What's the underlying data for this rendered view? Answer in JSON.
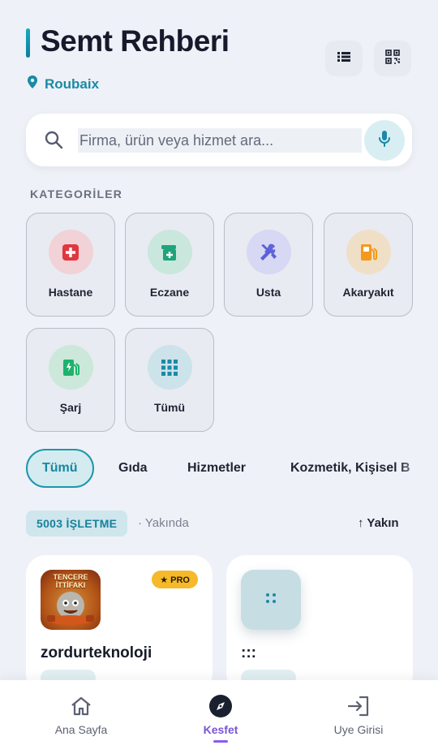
{
  "header": {
    "title": "Semt Rehberi",
    "location": "Roubaix",
    "accent": "#1a8aa6"
  },
  "search": {
    "placeholder": "Firma, ürün veya hizmet ara..."
  },
  "categories": {
    "heading": "KATEGORİLER",
    "items": [
      {
        "label": "Hastane",
        "icon": "hospital-icon",
        "color": "#e0383e"
      },
      {
        "label": "Eczane",
        "icon": "pharmacy-icon",
        "color": "#1fa37a"
      },
      {
        "label": "Usta",
        "icon": "tools-icon",
        "color": "#5b5fd8"
      },
      {
        "label": "Akaryakıt",
        "icon": "fuel-icon",
        "color": "#f39a1c"
      },
      {
        "label": "Şarj",
        "icon": "charging-icon",
        "color": "#1cb36c"
      },
      {
        "label": "Tümü",
        "icon": "grid-icon",
        "color": "#1a8aa6"
      }
    ]
  },
  "filters": {
    "items": [
      "Tümü",
      "Gıda",
      "Hizmetler",
      "Kozmetik, Kişisel B"
    ],
    "selected": "Tümü"
  },
  "listing": {
    "count_label": "5003 İŞLETME",
    "near_label": "· Yakında",
    "sort_label": "↑ Yakın"
  },
  "cards": [
    {
      "name": "zordurteknoloji",
      "badge": "★ PRO",
      "logo_text_1": "TENCERE",
      "logo_text_2": "İTTİFAKI"
    },
    {
      "name": ":::"
    }
  ],
  "bottom_nav": {
    "items": [
      {
        "label": "Ana Sayfa",
        "icon": "home-icon"
      },
      {
        "label": "Kesfet",
        "icon": "compass-icon"
      },
      {
        "label": "Uye Girisi",
        "icon": "login-icon"
      }
    ],
    "active": "Kesfet",
    "active_color": "#7a55d6"
  }
}
